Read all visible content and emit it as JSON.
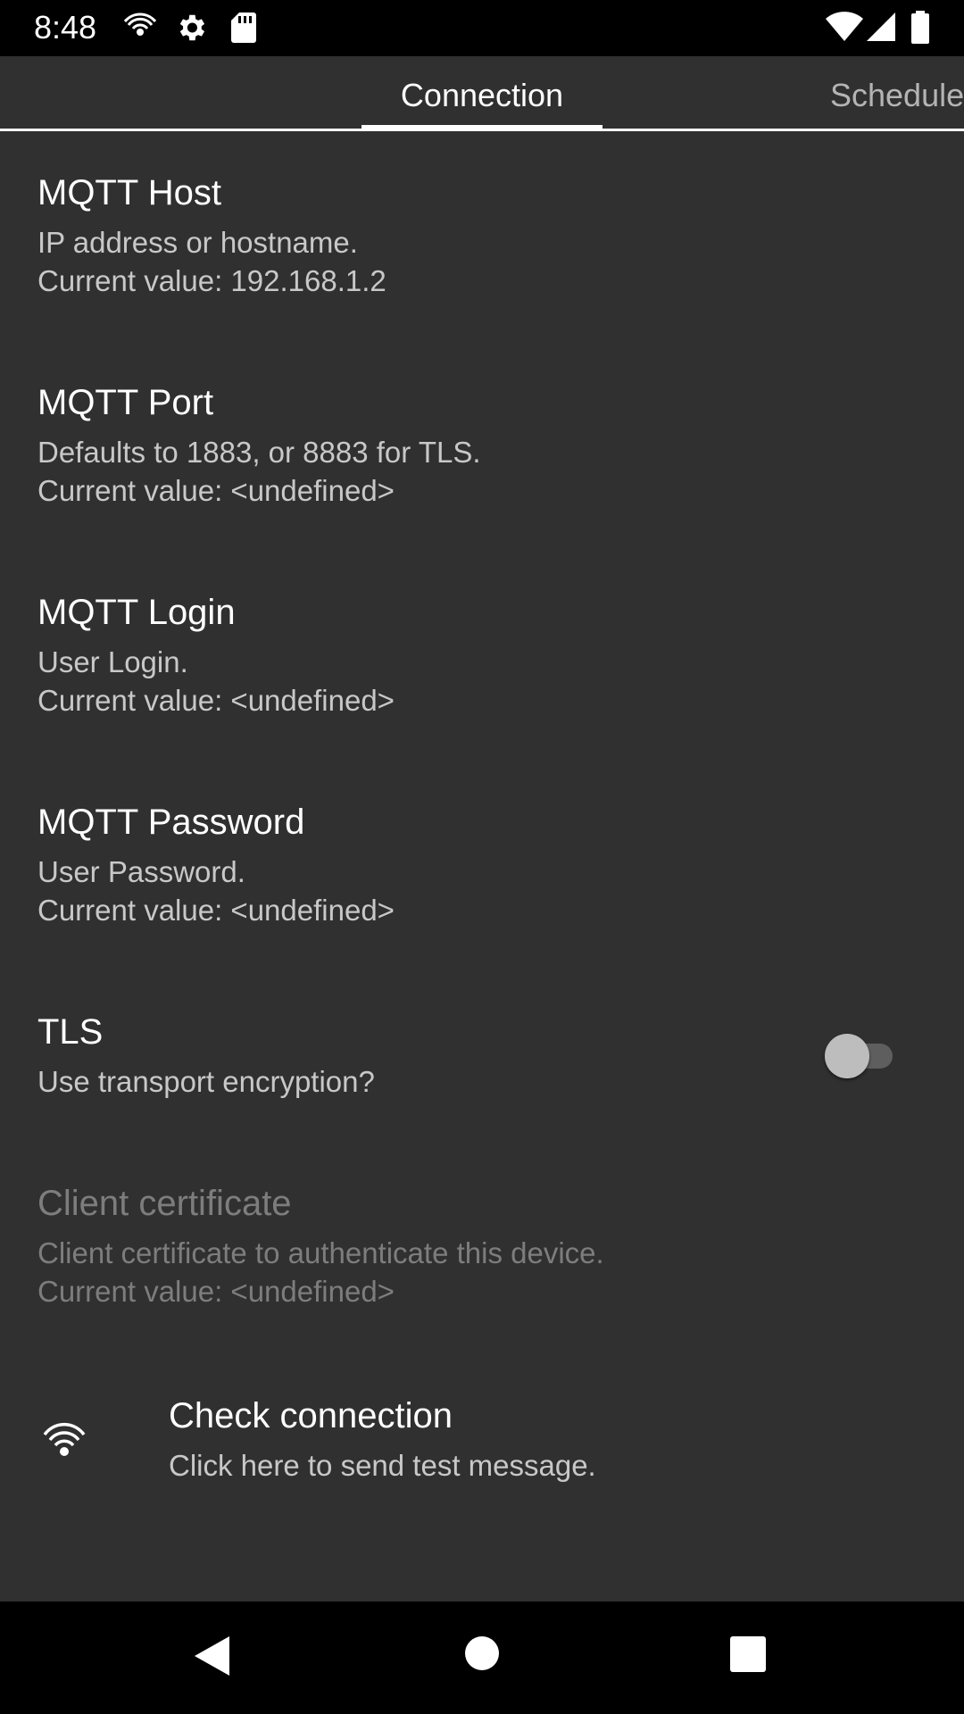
{
  "status_bar": {
    "time": "8:48",
    "left_icons": [
      "wireless-broadcast-icon",
      "gear-icon",
      "sd-card-icon"
    ],
    "right_icons": [
      "wifi-icon",
      "cell-signal-icon",
      "battery-icon"
    ]
  },
  "tabs": [
    {
      "label": "Connection",
      "active": true
    },
    {
      "label": "Schedule",
      "active": false
    }
  ],
  "preferences": {
    "mqtt_host": {
      "title": "MQTT Host",
      "summary": "IP address or hostname.",
      "value": "Current value: 192.168.1.2"
    },
    "mqtt_port": {
      "title": "MQTT Port",
      "summary": "Defaults to 1883, or 8883 for TLS.",
      "value": "Current value: <undefined>"
    },
    "mqtt_login": {
      "title": "MQTT Login",
      "summary": "User Login.",
      "value": "Current value: <undefined>"
    },
    "mqtt_password": {
      "title": "MQTT Password",
      "summary": "User Password.",
      "value": "Current value: <undefined>"
    },
    "tls": {
      "title": "TLS",
      "summary": "Use transport encryption?",
      "enabled": false
    },
    "client_certificate": {
      "title": "Client certificate",
      "summary": "Client certificate to authenticate this device.",
      "value": "Current value: <undefined>",
      "disabled": true
    },
    "check_connection": {
      "title": "Check connection",
      "summary": "Click here to send test message.",
      "icon": "wireless-broadcast-icon"
    }
  },
  "nav_bar": {
    "buttons": [
      "back-icon",
      "home-icon",
      "recents-icon"
    ]
  },
  "colors": {
    "background": "#303030",
    "bars": "#000000",
    "text_primary": "#ffffff",
    "text_secondary": "#c8c8c8",
    "text_disabled": "#7d7d7d"
  }
}
